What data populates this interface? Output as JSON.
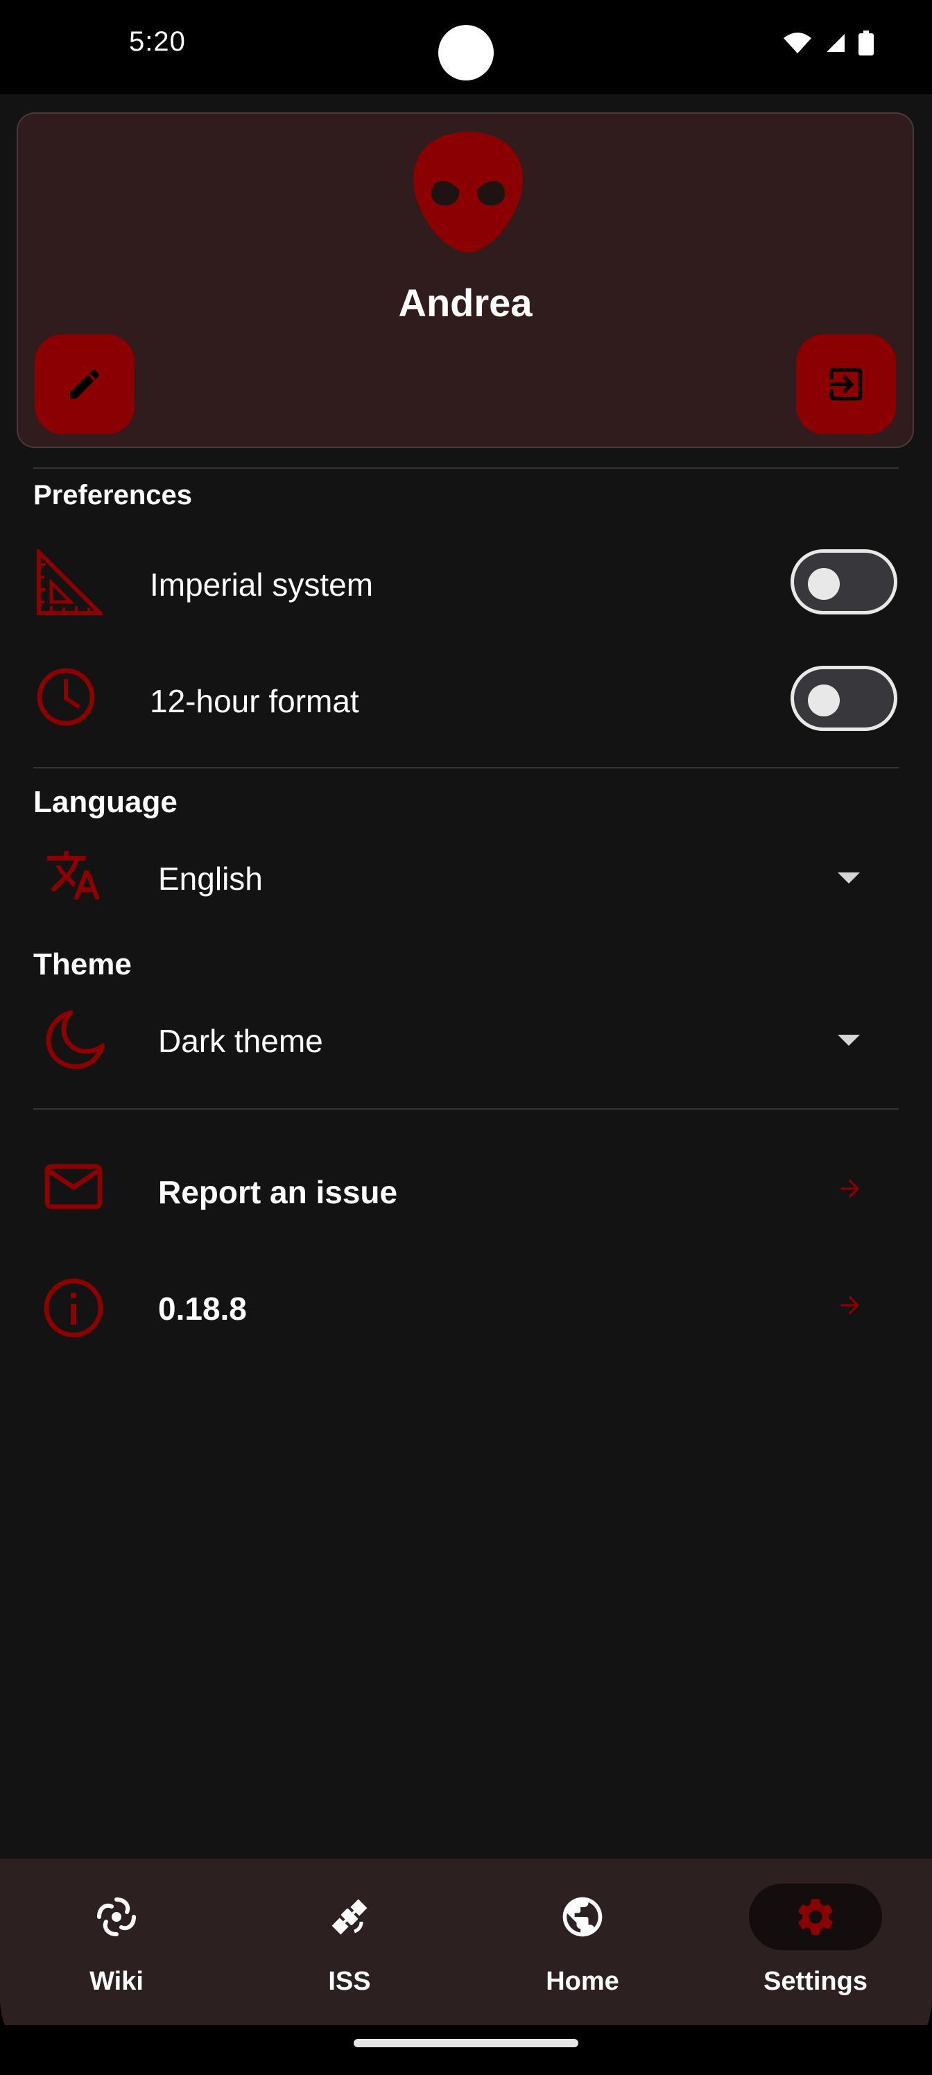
{
  "status_bar": {
    "time": "5:20"
  },
  "profile": {
    "name": "Andrea",
    "avatar_icon": "alien-icon",
    "edit_icon": "pencil-icon",
    "logout_icon": "logout-icon"
  },
  "preferences": {
    "title": "Preferences",
    "items": [
      {
        "icon": "set-square-icon",
        "label": "Imperial system",
        "enabled": false
      },
      {
        "icon": "clock-icon",
        "label": "12-hour format",
        "enabled": false
      }
    ]
  },
  "language": {
    "title": "Language",
    "icon": "translate-icon",
    "selected": "English"
  },
  "theme": {
    "title": "Theme",
    "icon": "moon-icon",
    "selected": "Dark theme"
  },
  "links": {
    "report": {
      "icon": "mail-icon",
      "label": "Report an issue"
    },
    "version": {
      "icon": "info-icon",
      "label": "0.18.8"
    }
  },
  "bottom_nav": {
    "items": [
      {
        "icon": "galaxy-icon",
        "label": "Wiki",
        "active": false
      },
      {
        "icon": "satellite-icon",
        "label": "ISS",
        "active": false
      },
      {
        "icon": "globe-icon",
        "label": "Home",
        "active": false
      },
      {
        "icon": "gear-icon",
        "label": "Settings",
        "active": true
      }
    ]
  },
  "colors": {
    "accent": "#8b0000",
    "background": "#131313",
    "card": "#301c1c",
    "nav_background": "#2c2020"
  }
}
